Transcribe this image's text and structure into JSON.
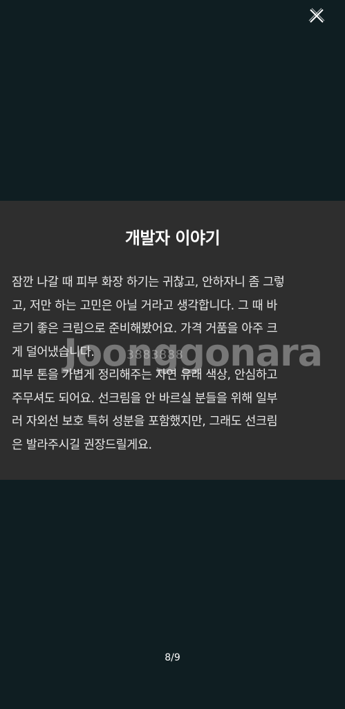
{
  "slide": {
    "title": "개발자 이야기",
    "lines": [
      "잠깐 나갈 때 피부 화장 하기는 귀찮고, 안하자니 좀 그렇",
      "고, 저만 하는 고민은 아닐 거라고 생각합니다. 그 때 바",
      "르기 좋은 크림으로 준비해봤어요. 가격 거품을 아주 크",
      "게 덜어냈습니다.",
      "피부 톤을 가볍게 정리해주는 자연 유래 색상, 안심하고",
      "주무셔도 되어요. 선크림을 안 바르실 분들을 위해 일부",
      "러 자외선 보호 특허 성분을 포함했지만, 그래도 선크림",
      "은 발라주시길 권장드릴게요."
    ]
  },
  "watermark": {
    "text": "Joonggonara",
    "sub": "3883888"
  },
  "pager": {
    "current": "8/9"
  },
  "icons": {
    "close": "close-icon"
  }
}
